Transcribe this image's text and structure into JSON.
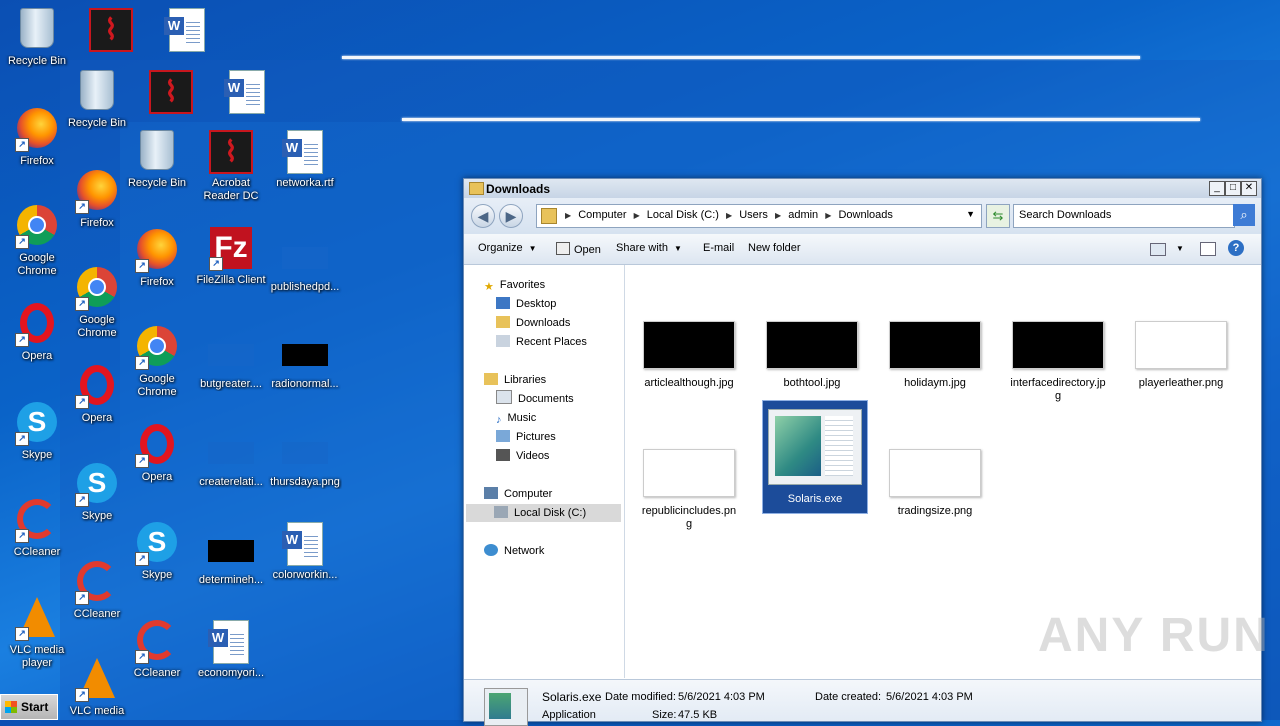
{
  "desktop": {
    "col1": [
      {
        "label": "Recycle Bin",
        "icon": "recycle-bin-icon"
      },
      {
        "label": "Firefox",
        "icon": "firefox-icon"
      },
      {
        "label": "Google Chrome",
        "icon": "chrome-icon"
      },
      {
        "label": "Opera",
        "icon": "opera-icon"
      },
      {
        "label": "Skype",
        "icon": "skype-icon"
      },
      {
        "label": "CCleaner",
        "icon": "ccleaner-icon"
      },
      {
        "label": "VLC media player",
        "icon": "vlc-icon"
      }
    ],
    "col2": [
      {
        "label": "Recycle Bin"
      },
      {
        "label": "Firefox"
      },
      {
        "label": "Google Chrome"
      },
      {
        "label": "Opera"
      },
      {
        "label": "Skype"
      },
      {
        "label": "CCleaner"
      },
      {
        "label": "VLC media"
      }
    ],
    "col3": [
      {
        "label": "Recycle Bin"
      },
      {
        "label": "Firefox"
      },
      {
        "label": "Google Chrome"
      },
      {
        "label": "Opera"
      },
      {
        "label": "Skype"
      },
      {
        "label": "CCleaner"
      }
    ],
    "col4": [
      {
        "label": "Acrobat Reader DC"
      },
      {
        "label": "FileZilla Client"
      },
      {
        "label": "butgreater...."
      },
      {
        "label": "createrelati..."
      },
      {
        "label": "determineh..."
      },
      {
        "label": "economyori..."
      }
    ],
    "col5": [
      {
        "label": "networka.rtf"
      },
      {
        "label": "publishedpd..."
      },
      {
        "label": "radionormal..."
      },
      {
        "label": "thursdaya.png"
      },
      {
        "label": "colorworkin..."
      }
    ]
  },
  "window": {
    "title": "Downloads",
    "address": [
      "Computer",
      "Local Disk (C:)",
      "Users",
      "admin",
      "Downloads"
    ],
    "search_placeholder": "Search Downloads",
    "toolbar": {
      "organize": "Organize",
      "open": "Open",
      "share_with": "Share with",
      "email": "E-mail",
      "new_folder": "New folder"
    },
    "nav": {
      "favorites": "Favorites",
      "desktop": "Desktop",
      "downloads": "Downloads",
      "recent": "Recent Places",
      "libraries": "Libraries",
      "documents": "Documents",
      "music": "Music",
      "pictures": "Pictures",
      "videos": "Videos",
      "computer": "Computer",
      "local_disk": "Local Disk (C:)",
      "network": "Network"
    },
    "files": [
      {
        "name": "articlealthough.jpg"
      },
      {
        "name": "bothtool.jpg"
      },
      {
        "name": "holidaym.jpg"
      },
      {
        "name": "interfacedirectory.jpg"
      },
      {
        "name": "playerleather.png"
      },
      {
        "name": "republicincludes.png"
      },
      {
        "name": "Solaris.exe"
      },
      {
        "name": "tradingsize.png"
      }
    ],
    "details": {
      "name": "Solaris.exe",
      "type": "Application",
      "modified_label": "Date modified:",
      "modified": "5/6/2021 4:03 PM",
      "created_label": "Date created:",
      "created": "5/6/2021 4:03 PM",
      "size_label": "Size:",
      "size": "47.5 KB"
    }
  },
  "taskbar": {
    "start": "Start"
  },
  "watermark": "ANY RUN"
}
